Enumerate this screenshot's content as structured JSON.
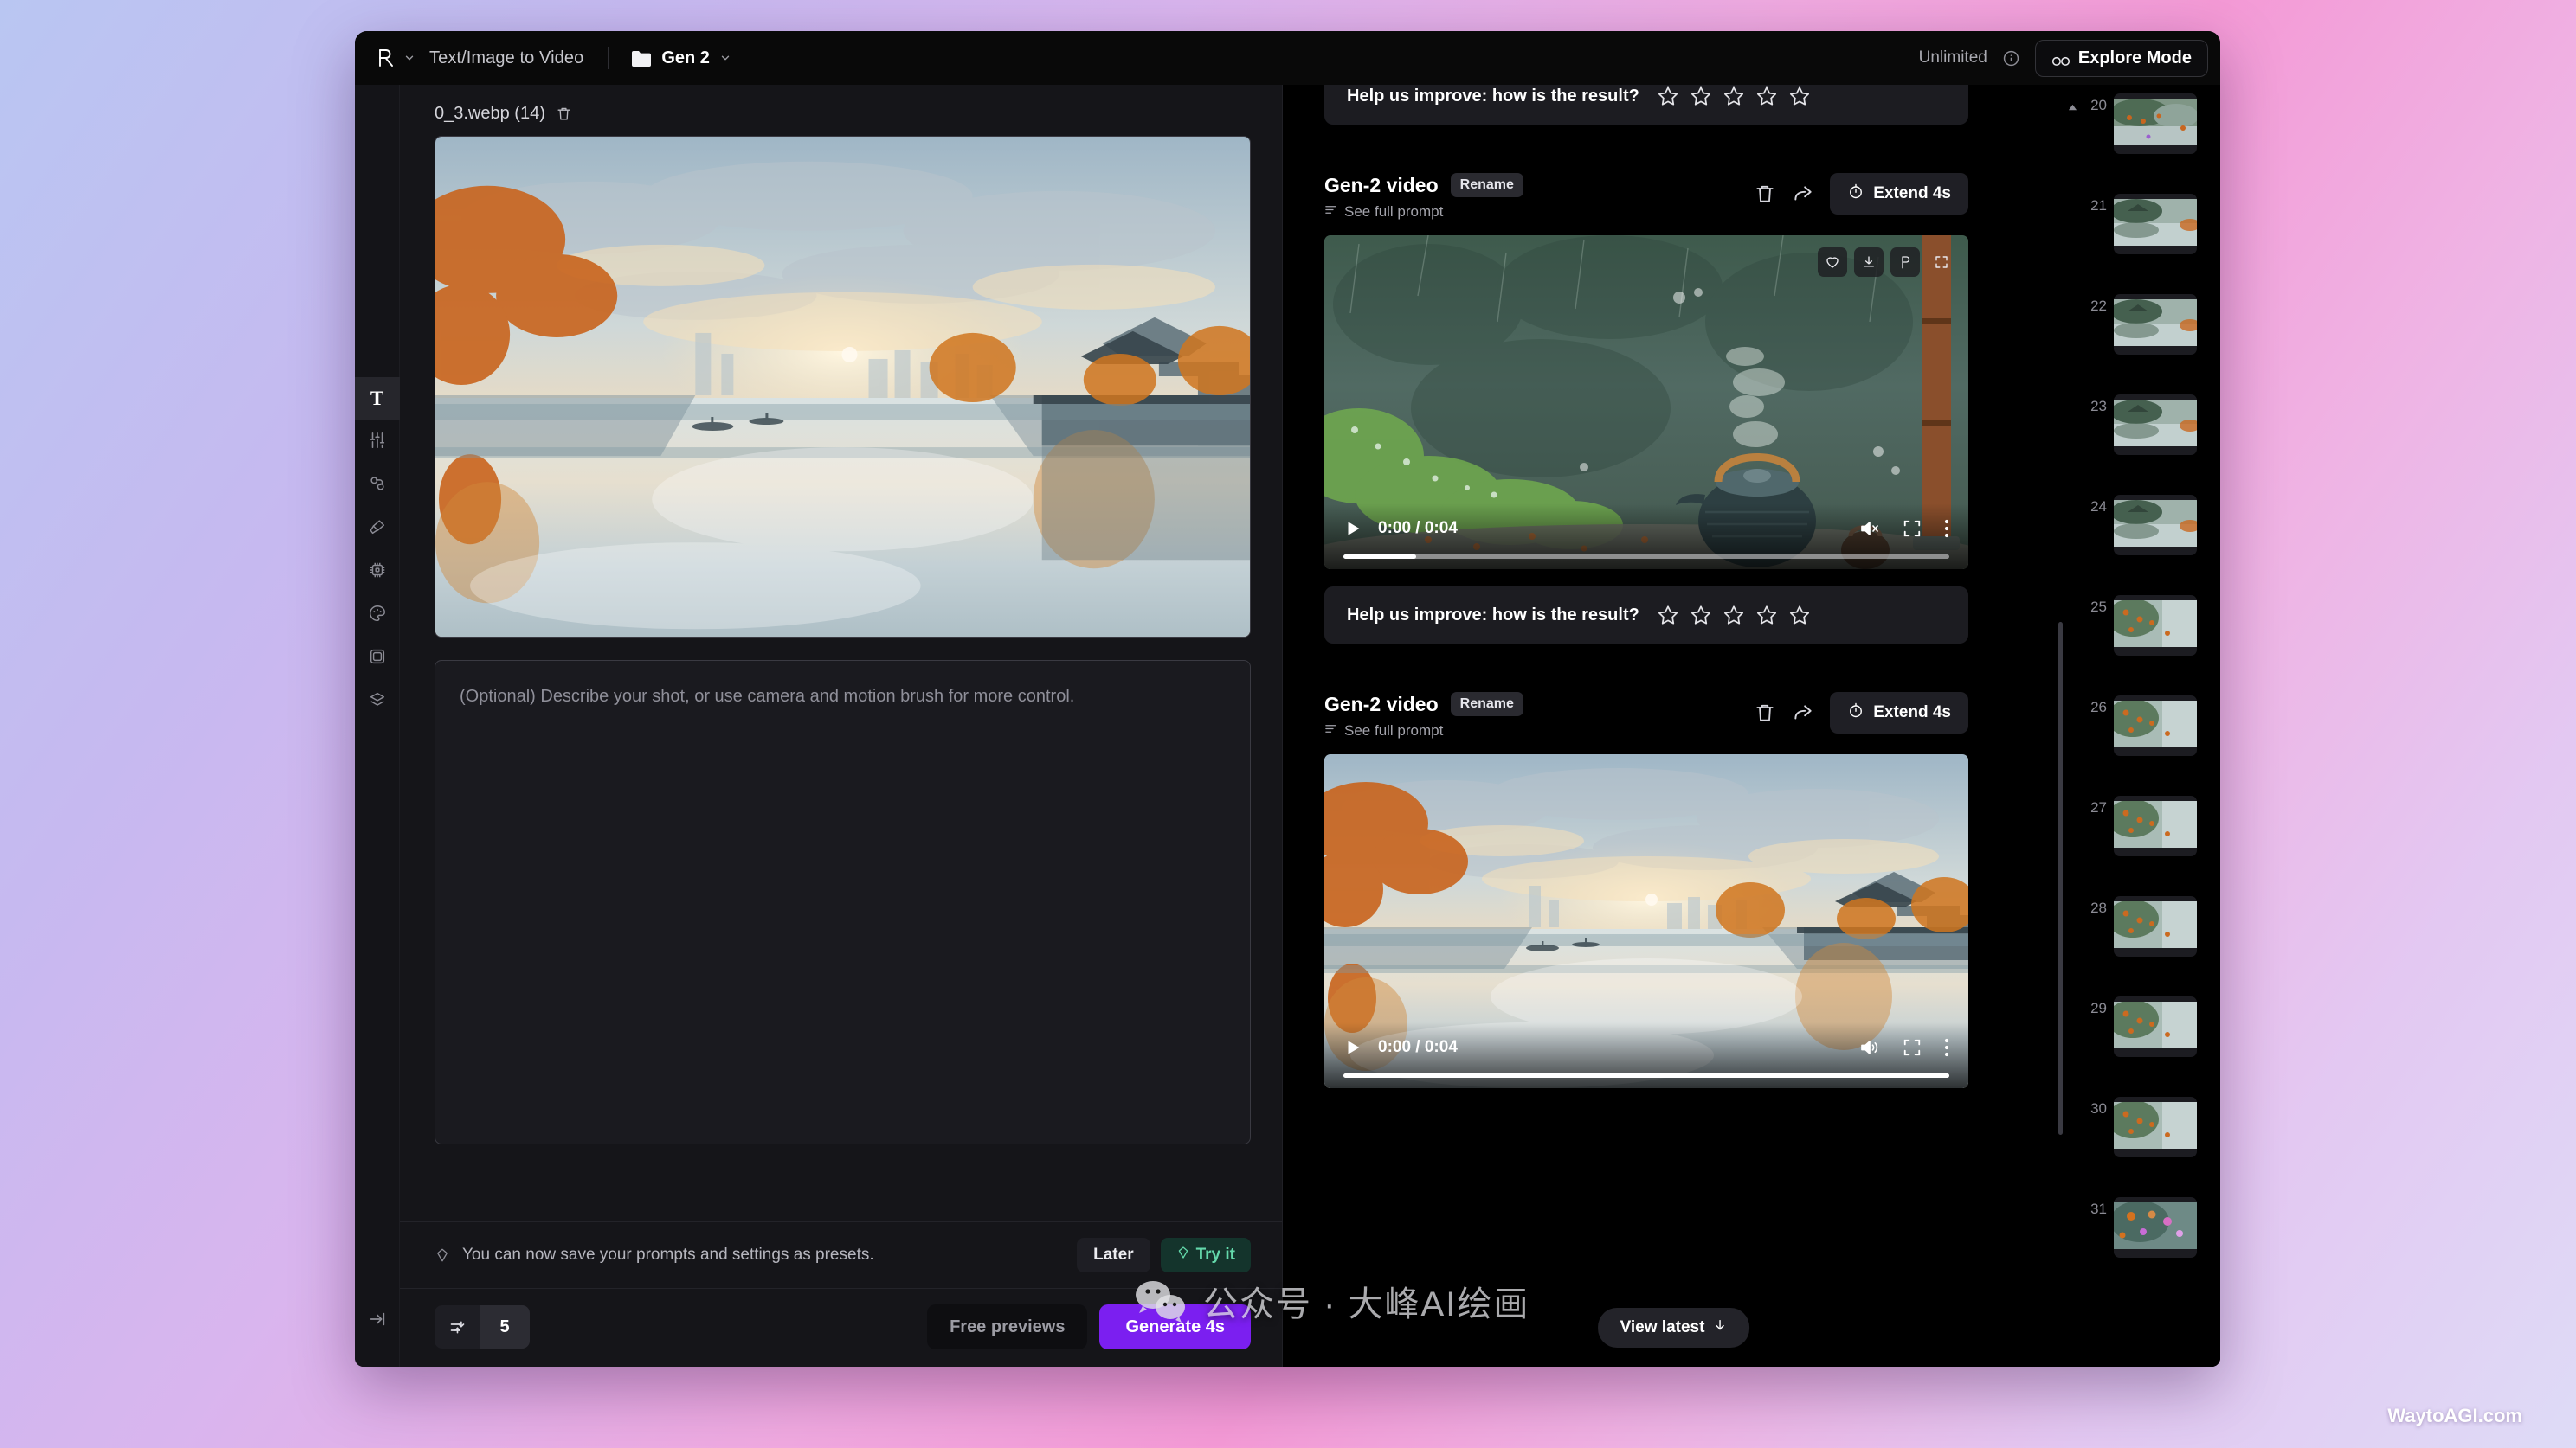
{
  "topbar": {
    "logo_icon": "runway-logo-icon",
    "logo_chevron_icon": "chevron-down-icon",
    "mode_label": "Text/Image to Video",
    "folder_icon": "folder-icon",
    "folder_name": "Gen 2",
    "folder_chevron_icon": "chevron-down-icon",
    "credits_label": "Unlimited",
    "info_icon": "info-circle-icon",
    "explore_icon": "infinity-icon",
    "explore_label": "Explore Mode"
  },
  "rail": {
    "items": [
      {
        "name": "text-tool",
        "icon": "text-T-icon",
        "active": true
      },
      {
        "name": "settings-tool",
        "icon": "sliders-icon",
        "active": false
      },
      {
        "name": "camera-motion-tool",
        "icon": "camera-motion-icon",
        "active": false
      },
      {
        "name": "motion-brush-tool",
        "icon": "brush-icon",
        "active": false
      },
      {
        "name": "model-tool",
        "icon": "chip-icon",
        "active": false
      },
      {
        "name": "style-tool",
        "icon": "palette-icon",
        "active": false
      },
      {
        "name": "frame-tool",
        "icon": "frame-icon",
        "active": false
      },
      {
        "name": "layers-tool",
        "icon": "layers-icon",
        "active": false
      }
    ],
    "collapse_icon": "collapse-panel-icon"
  },
  "left_panel": {
    "file_name": "0_3.webp (14)",
    "delete_icon": "trash-icon",
    "preview_alt": "uploaded reference image: misty autumn canal town at sunrise",
    "prompt_placeholder": "(Optional) Describe your shot, or use camera and motion brush for more control.",
    "prompt_value": "",
    "preset_banner": {
      "icon": "preset-diamond-icon",
      "text": "You can now save your prompts and settings as presets.",
      "later_label": "Later",
      "try_icon": "preset-diamond-icon",
      "try_label": "Try it"
    },
    "bottom_bar": {
      "seed_icon": "seed-sliders-icon",
      "seed_value": "5",
      "free_previews_label": "Free previews",
      "generate_label": "Generate 4s"
    }
  },
  "feed": {
    "top_rating": {
      "text": "Help us improve: how is the result?",
      "stars": 5,
      "star_icon": "star-outline-icon"
    },
    "cards": [
      {
        "title": "Gen-2 video",
        "rename_label": "Rename",
        "see_prompt_icon": "prompt-lines-icon",
        "see_prompt_label": "See full prompt",
        "delete_icon": "trash-icon",
        "share_icon": "share-arrow-icon",
        "extend_icon": "stopwatch-icon",
        "extend_label": "Extend 4s",
        "video_alt": "rainy green forest with steaming iron teapot",
        "overlay_icons": [
          "heart-icon",
          "download-icon",
          "pin-prompt-icon",
          "expand-icon"
        ],
        "play_icon": "play-icon",
        "time": "0:00 / 0:04",
        "controls": {
          "volume_icon": "volume-muted-icon",
          "fullscreen_icon": "fullscreen-icon",
          "more_icon": "kebab-menu-icon"
        },
        "progress_percent": 12,
        "rating": {
          "text": "Help us improve: how is the result?",
          "stars": 5
        }
      },
      {
        "title": "Gen-2 video",
        "rename_label": "Rename",
        "see_prompt_icon": "prompt-lines-icon",
        "see_prompt_label": "See full prompt",
        "delete_icon": "trash-icon",
        "share_icon": "share-arrow-icon",
        "extend_icon": "stopwatch-icon",
        "extend_label": "Extend 4s",
        "video_alt": "misty autumn canal town at sunrise",
        "overlay_icons": [],
        "play_icon": "play-icon",
        "time": "0:00 / 0:04",
        "controls": {
          "volume_icon": "volume-on-icon",
          "fullscreen_icon": "fullscreen-icon",
          "more_icon": "kebab-menu-icon"
        },
        "progress_percent": 100
      }
    ],
    "view_latest_label": "View latest",
    "view_latest_icon": "arrow-down-icon"
  },
  "thumbnails": {
    "caret_icon": "caret-up-icon",
    "items": [
      {
        "num": "20",
        "variant": "a"
      },
      {
        "num": "21",
        "variant": "b"
      },
      {
        "num": "22",
        "variant": "b"
      },
      {
        "num": "23",
        "variant": "b"
      },
      {
        "num": "24",
        "variant": "b"
      },
      {
        "num": "25",
        "variant": "c"
      },
      {
        "num": "26",
        "variant": "c"
      },
      {
        "num": "27",
        "variant": "c"
      },
      {
        "num": "28",
        "variant": "c"
      },
      {
        "num": "29",
        "variant": "c"
      },
      {
        "num": "30",
        "variant": "c"
      },
      {
        "num": "31",
        "variant": "d"
      }
    ]
  },
  "watermark": {
    "icon": "wechat-icon",
    "text": "公众号 · 大峰AI绘画"
  },
  "corner_brand": "WaytoAGI.com",
  "colors": {
    "accent_generate": "#7b1ff0",
    "try_it_green": "#64d9ab",
    "window_bg": "#0d0d0f",
    "panel_bg": "#151519"
  }
}
